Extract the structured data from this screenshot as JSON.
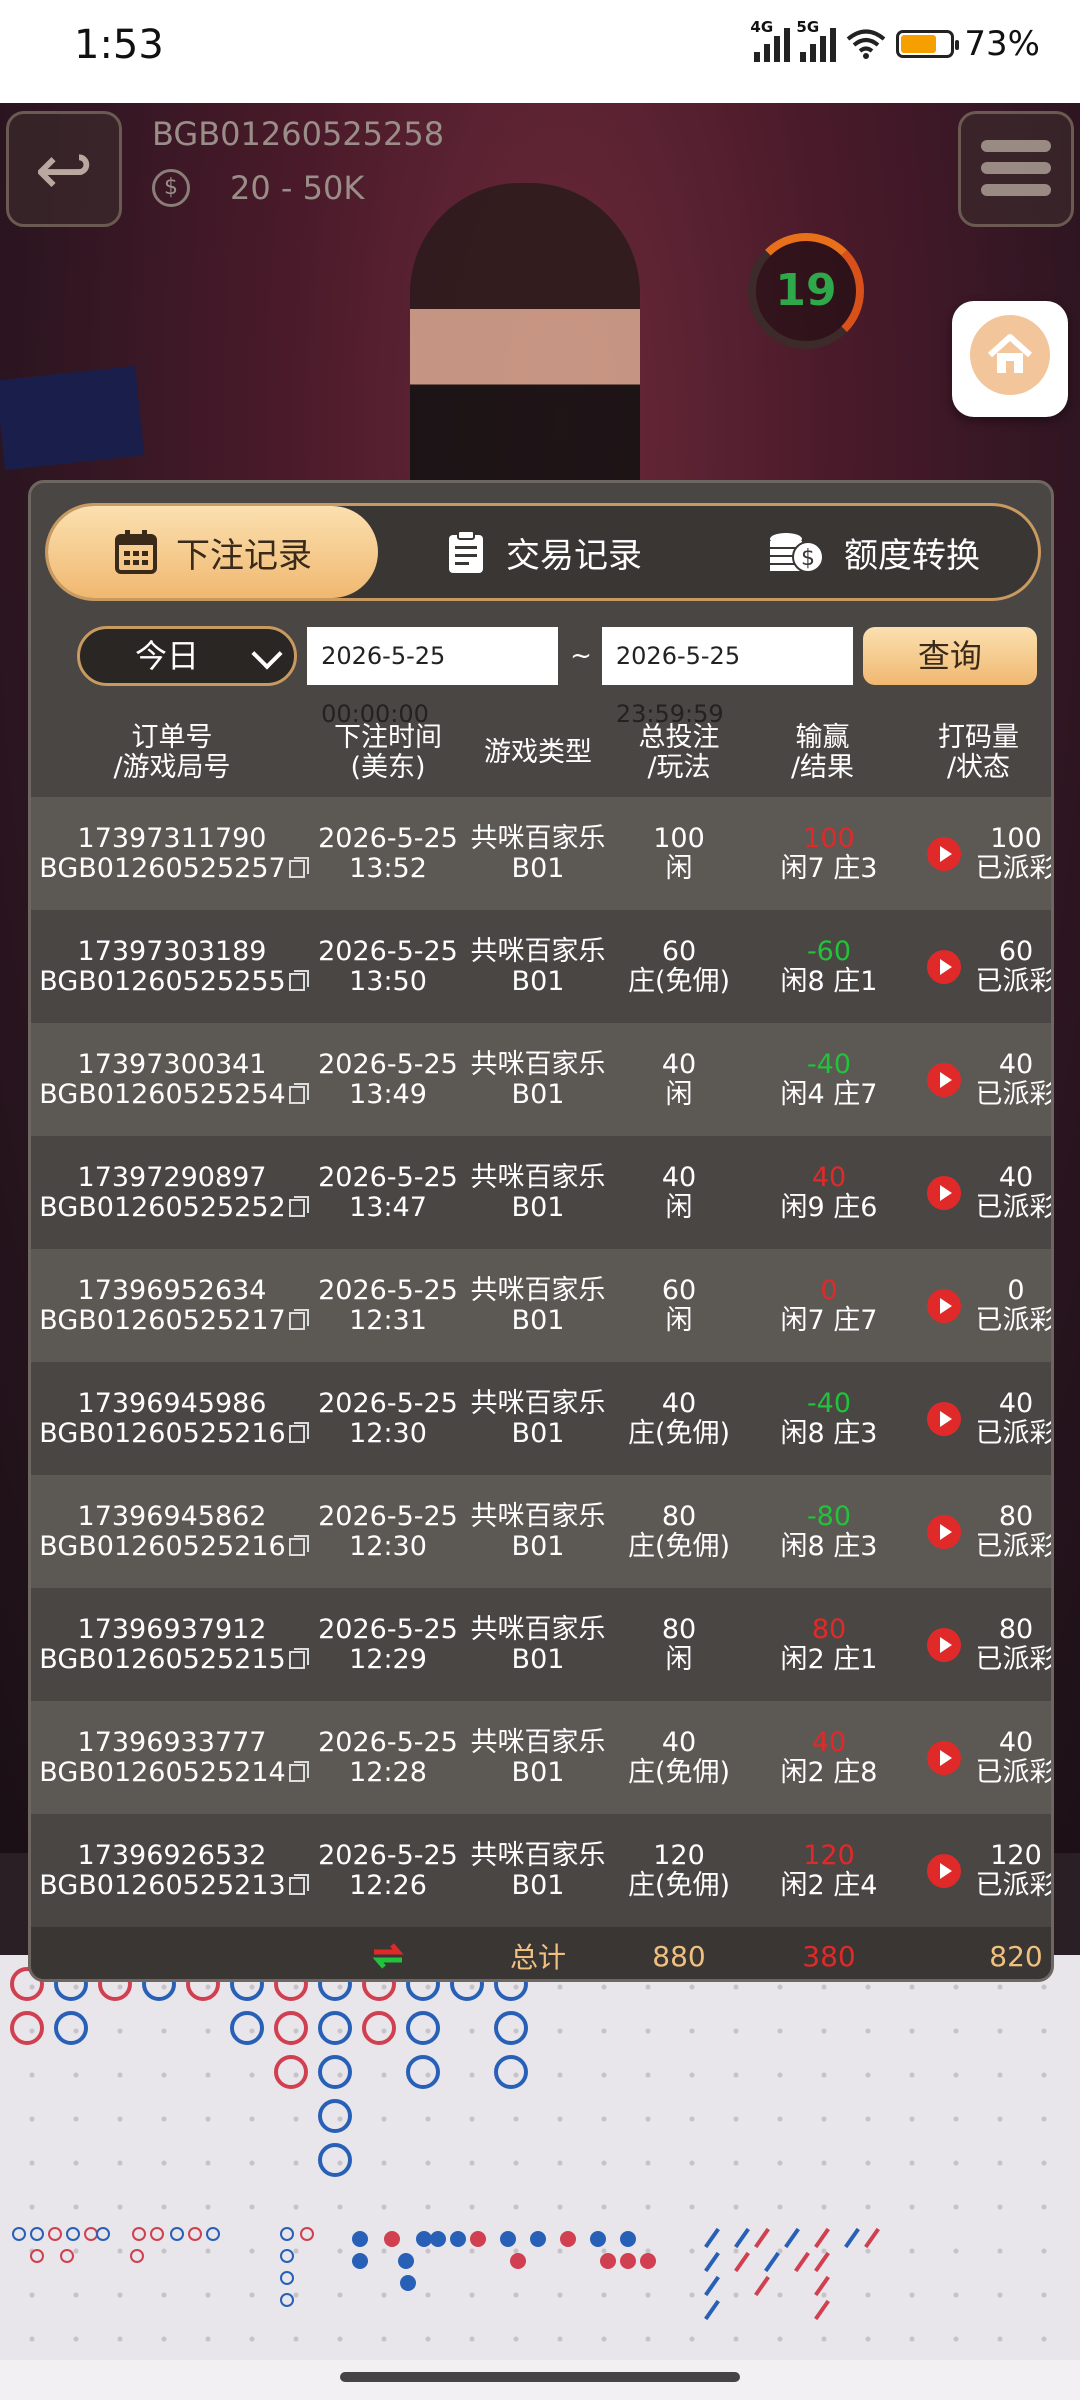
{
  "status_bar": {
    "time": "1:53",
    "net1": "4G",
    "net2": "5G",
    "battery": "73%",
    "battery_level": 0.73
  },
  "game": {
    "table_id": "BGB01260525258",
    "limit": "20 - 50K",
    "countdown": "19"
  },
  "modal": {
    "tabs": [
      {
        "label": "下注记录",
        "icon": "calendar-icon",
        "active": true
      },
      {
        "label": "交易记录",
        "icon": "clipboard-icon",
        "active": false
      },
      {
        "label": "额度转换",
        "icon": "coins-icon",
        "active": false
      }
    ],
    "filter": {
      "period": "今日",
      "start": "2026-5-25 00:00:00",
      "separator": "~",
      "end": "2026-5-25 23:59:59",
      "query_label": "查询"
    },
    "headers": {
      "order": [
        "订单号",
        "/游戏局号"
      ],
      "time": [
        "下注时间",
        "(美东)"
      ],
      "type": "游戏类型",
      "bet": [
        "总投注",
        "/玩法"
      ],
      "result": [
        "输赢",
        "/结果"
      ],
      "valid": [
        "打码量",
        "/状态"
      ]
    },
    "rows": [
      {
        "order": "17397311790",
        "round": "BGB01260525257",
        "date": "2026-5-25",
        "time": "13:52",
        "game": "共咪百家乐",
        "table": "B01",
        "bet": "100",
        "play": "闲",
        "winloss": "100",
        "outcome": "win",
        "result": "闲7 庄3",
        "valid": "100",
        "status": "已派彩"
      },
      {
        "order": "17397303189",
        "round": "BGB01260525255",
        "date": "2026-5-25",
        "time": "13:50",
        "game": "共咪百家乐",
        "table": "B01",
        "bet": "60",
        "play": "庄(免佣)",
        "winloss": "-60",
        "outcome": "lose",
        "result": "闲8 庄1",
        "valid": "60",
        "status": "已派彩"
      },
      {
        "order": "17397300341",
        "round": "BGB01260525254",
        "date": "2026-5-25",
        "time": "13:49",
        "game": "共咪百家乐",
        "table": "B01",
        "bet": "40",
        "play": "闲",
        "winloss": "-40",
        "outcome": "lose",
        "result": "闲4 庄7",
        "valid": "40",
        "status": "已派彩"
      },
      {
        "order": "17397290897",
        "round": "BGB01260525252",
        "date": "2026-5-25",
        "time": "13:47",
        "game": "共咪百家乐",
        "table": "B01",
        "bet": "40",
        "play": "闲",
        "winloss": "40",
        "outcome": "win",
        "result": "闲9 庄6",
        "valid": "40",
        "status": "已派彩"
      },
      {
        "order": "17396952634",
        "round": "BGB01260525217",
        "date": "2026-5-25",
        "time": "12:31",
        "game": "共咪百家乐",
        "table": "B01",
        "bet": "60",
        "play": "闲",
        "winloss": "0",
        "outcome": "win",
        "result": "闲7 庄7",
        "valid": "0",
        "status": "已派彩"
      },
      {
        "order": "17396945986",
        "round": "BGB01260525216",
        "date": "2026-5-25",
        "time": "12:30",
        "game": "共咪百家乐",
        "table": "B01",
        "bet": "40",
        "play": "庄(免佣)",
        "winloss": "-40",
        "outcome": "lose",
        "result": "闲8 庄3",
        "valid": "40",
        "status": "已派彩"
      },
      {
        "order": "17396945862",
        "round": "BGB01260525216",
        "date": "2026-5-25",
        "time": "12:30",
        "game": "共咪百家乐",
        "table": "B01",
        "bet": "80",
        "play": "庄(免佣)",
        "winloss": "-80",
        "outcome": "lose",
        "result": "闲8 庄3",
        "valid": "80",
        "status": "已派彩"
      },
      {
        "order": "17396937912",
        "round": "BGB01260525215",
        "date": "2026-5-25",
        "time": "12:29",
        "game": "共咪百家乐",
        "table": "B01",
        "bet": "80",
        "play": "闲",
        "winloss": "80",
        "outcome": "win",
        "result": "闲2 庄1",
        "valid": "80",
        "status": "已派彩"
      },
      {
        "order": "17396933777",
        "round": "BGB01260525214",
        "date": "2026-5-25",
        "time": "12:28",
        "game": "共咪百家乐",
        "table": "B01",
        "bet": "40",
        "play": "庄(免佣)",
        "winloss": "40",
        "outcome": "win",
        "result": "闲2 庄8",
        "valid": "40",
        "status": "已派彩"
      },
      {
        "order": "17396926532",
        "round": "BGB01260525213",
        "date": "2026-5-25",
        "time": "12:26",
        "game": "共咪百家乐",
        "table": "B01",
        "bet": "120",
        "play": "庄(免佣)",
        "winloss": "120",
        "outcome": "win",
        "result": "闲2 庄4",
        "valid": "120",
        "status": "已派彩"
      }
    ],
    "totals": {
      "label": "总计",
      "bet": "880",
      "winloss": "380",
      "valid": "820"
    }
  },
  "colors": {
    "accent": "#f0b870",
    "win": "#e02a2a",
    "lose": "#22c23a",
    "banker": "#d04050",
    "player": "#2860b8"
  }
}
